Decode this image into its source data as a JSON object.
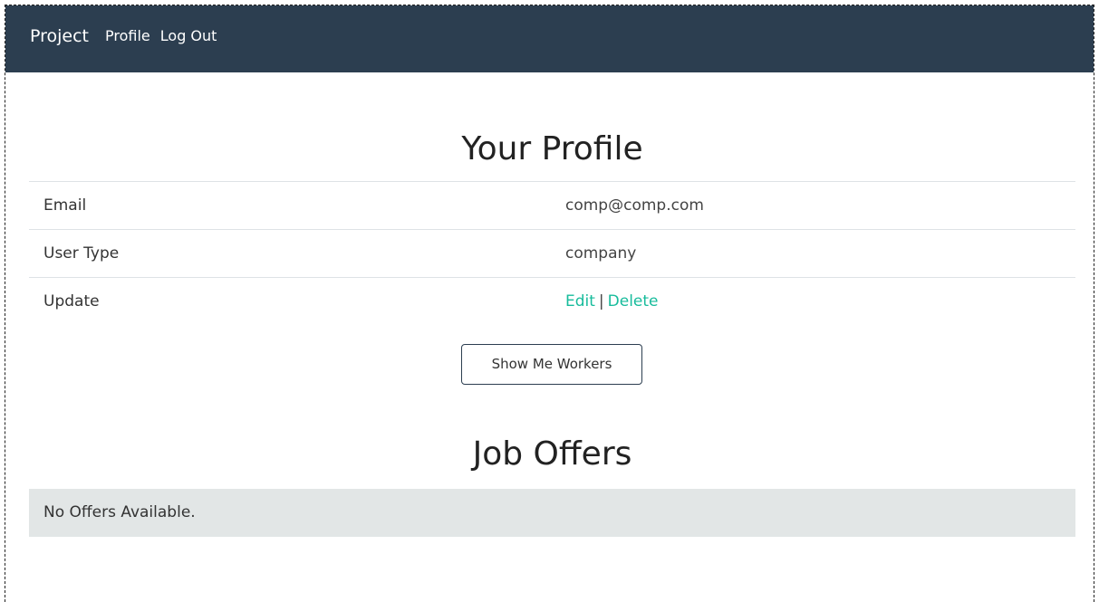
{
  "navbar": {
    "brand": "Project",
    "links": [
      "Profile",
      "Log Out"
    ],
    "background": "#2c3e50"
  },
  "profile": {
    "title": "Your Profile",
    "rows": [
      {
        "label": "Email",
        "value": "comp@comp.com"
      },
      {
        "label": "User Type",
        "value": "company"
      }
    ],
    "update": {
      "label": "Update",
      "edit_label": "Edit",
      "separator": "|",
      "delete_label": "Delete"
    },
    "link_color": "#18bc9c"
  },
  "workers_button": {
    "label": "Show Me Workers"
  },
  "offers": {
    "title": "Job Offers",
    "empty_message": "No Offers Available."
  }
}
